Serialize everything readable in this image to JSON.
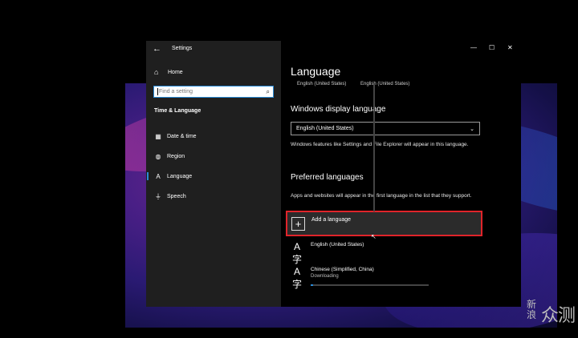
{
  "window": {
    "title": "Settings",
    "controls": {
      "minimize": "—",
      "maximize": "☐",
      "close": "✕"
    }
  },
  "sidebar": {
    "home_label": "Home",
    "search_placeholder": "Find a setting",
    "section_title": "Time & Language",
    "items": [
      {
        "label": "Date & time",
        "icon": "calendar-clock-icon"
      },
      {
        "label": "Region",
        "icon": "globe-icon"
      },
      {
        "label": "Language",
        "icon": "language-icon",
        "active": true
      },
      {
        "label": "Speech",
        "icon": "microphone-icon"
      }
    ]
  },
  "content": {
    "title": "Language",
    "crumbs": [
      "English (United States)",
      "English (United States)"
    ],
    "display_language": {
      "heading": "Windows display language",
      "selected": "English (United States)",
      "description": "Windows features like Settings and File Explorer will appear in this language."
    },
    "preferred": {
      "heading": "Preferred languages",
      "description": "Apps and websites will appear in the first language in the list that they support.",
      "add_label": "Add a language",
      "languages": [
        {
          "name": "English (United States)",
          "status": ""
        },
        {
          "name": "Chinese (Simplified, China)",
          "status": "Downloading",
          "progress": 0.02
        }
      ]
    }
  },
  "watermark": {
    "line1": "新",
    "line2": "浪",
    "text": "众测"
  },
  "colors": {
    "accent": "#2a8ad6",
    "highlight": "#e0242a",
    "sidebar_bg": "#1f1f1f"
  }
}
